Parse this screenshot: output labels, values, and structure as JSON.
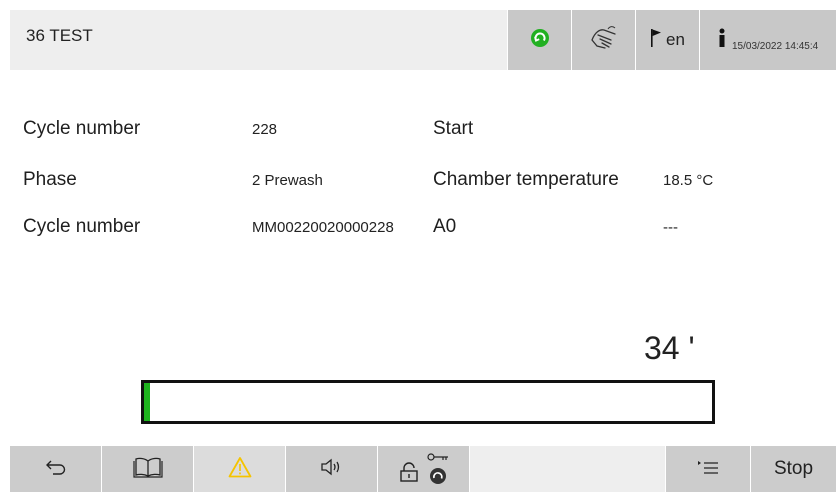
{
  "header": {
    "title": "36 TEST",
    "language": "en",
    "datetime": "15/03/2022 14:45:4"
  },
  "rows": [
    {
      "label": "Cycle number",
      "value": "228",
      "label2": "Start",
      "value2": ""
    },
    {
      "label": "Phase",
      "value": "2 Prewash",
      "label2": "Chamber temperature",
      "value2": "18.5 °C"
    },
    {
      "label": "Cycle number",
      "value": "MM00220020000228",
      "label2": "A0",
      "value2": "---"
    }
  ],
  "remaining_time": "34 '",
  "progress_fraction": 0.01,
  "toolbar": {
    "stop_label": "Stop",
    "icons": [
      "back-arrow-icon",
      "book-icon",
      "warning-icon",
      "speaker-icon",
      "lock-icon",
      "key-icon",
      "program-icon",
      "menu-list-icon"
    ]
  },
  "colors": {
    "accent_green": "#1eb31e",
    "status_green": "#22b022",
    "warning_yellow": "#f5c400",
    "bar_gray": "#cccccc"
  }
}
